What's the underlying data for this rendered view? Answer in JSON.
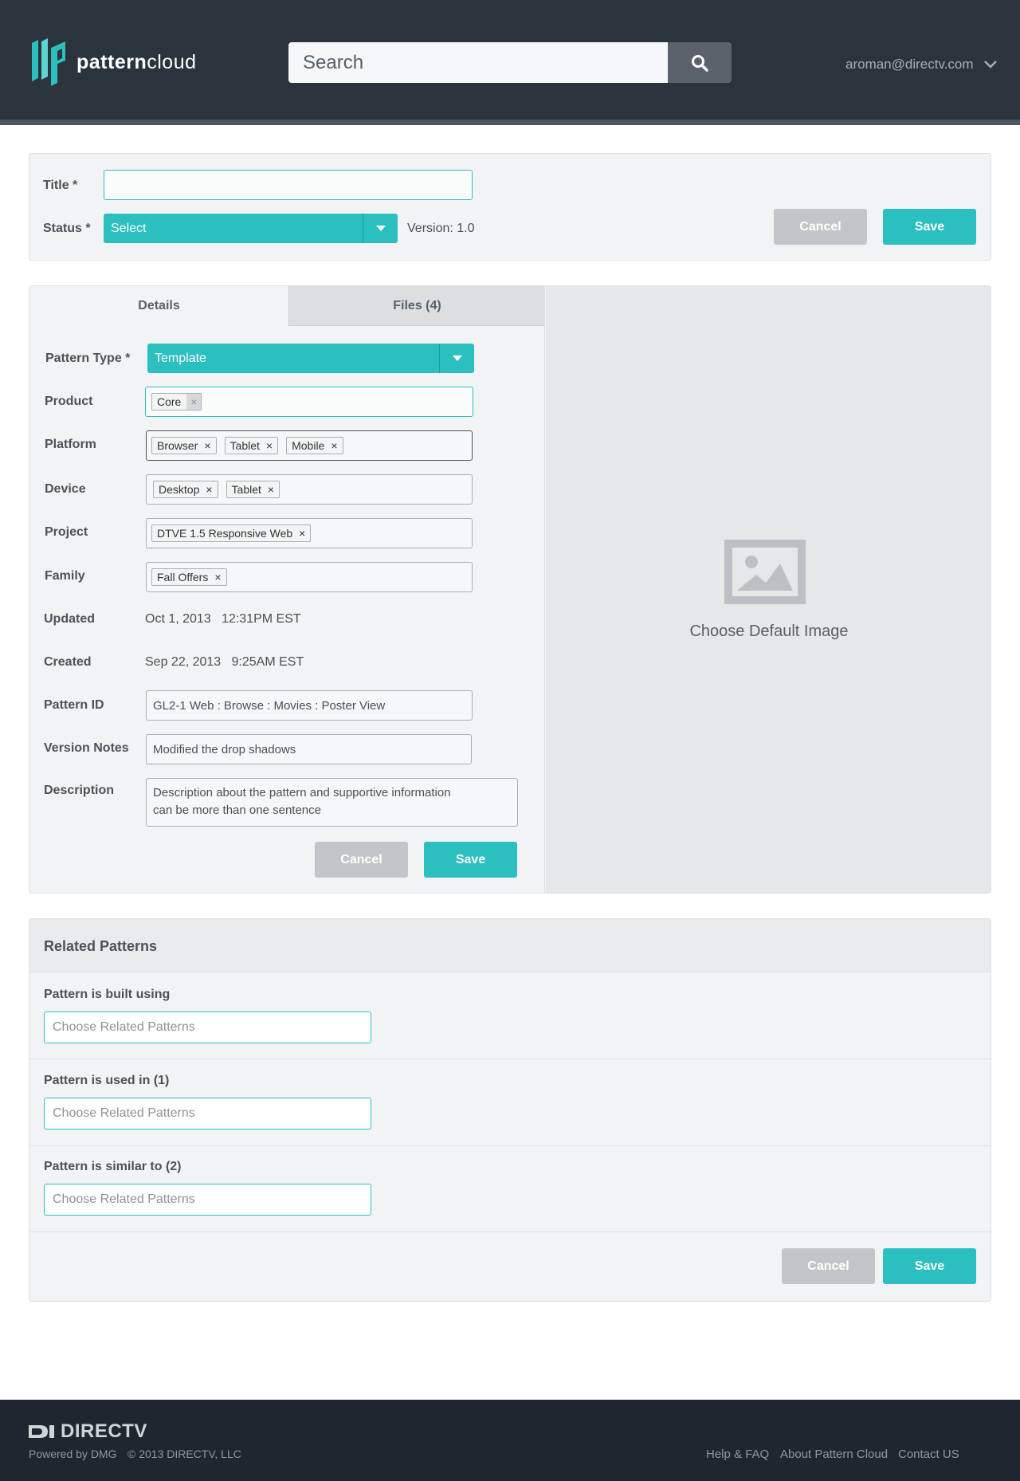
{
  "header": {
    "logo_text_bold": "pattern",
    "logo_text_light": "cloud",
    "search_placeholder": "Search",
    "user_email": "aroman@directv.com"
  },
  "top_form": {
    "title_label": "Title *",
    "title_value": "",
    "status_label": "Status *",
    "status_value": "Select",
    "version": "Version: 1.0",
    "cancel_label": "Cancel",
    "save_label": "Save"
  },
  "tabs": [
    {
      "label": "Details",
      "active": true
    },
    {
      "label": "Files (4)",
      "active": false
    }
  ],
  "details": {
    "pattern_type_label": "Pattern Type *",
    "pattern_type_value": "Template",
    "product_label": "Product",
    "product_tags": [
      "Core"
    ],
    "platform_label": "Platform",
    "platform_tags": [
      "Browser",
      "Tablet",
      "Mobile"
    ],
    "device_label": "Device",
    "device_tags": [
      "Desktop",
      "Tablet"
    ],
    "project_label": "Project",
    "project_tags": [
      "DTVE 1.5 Responsive Web"
    ],
    "family_label": "Family",
    "family_tags": [
      "Fall Offers"
    ],
    "updated_label": "Updated",
    "updated_value": "Oct 1, 2013   12:31PM EST",
    "created_label": "Created",
    "created_value": "Sep 22, 2013   9:25AM EST",
    "pattern_id_label": "Pattern ID",
    "pattern_id_value": "GL2-1 Web : Browse : Movies : Poster View",
    "version_notes_label": "Version Notes",
    "version_notes_value": "Modified the drop shadows",
    "description_label": "Description",
    "description_value": "Description about the pattern and supportive information can be more than one sentence",
    "cancel_label": "Cancel",
    "save_label": "Save"
  },
  "image_panel": {
    "choose_label": "Choose Default Image"
  },
  "related": {
    "heading": "Related Patterns",
    "sections": [
      {
        "label": "Pattern is built using",
        "placeholder": "Choose Related Patterns"
      },
      {
        "label": "Pattern is used in (1)",
        "placeholder": "Choose Related Patterns"
      },
      {
        "label": "Pattern is similar to (2)",
        "placeholder": "Choose Related Patterns"
      }
    ],
    "cancel_label": "Cancel",
    "save_label": "Save"
  },
  "footer": {
    "brand": "DIRECTV",
    "powered": "Powered by DMG",
    "copyright": "© 2013 DIRECTV, LLC",
    "links": [
      "Help & FAQ",
      "About Pattern Cloud",
      "Contact US"
    ]
  },
  "colors": {
    "accent": "#2bbfbf",
    "header_bg": "#2b333c",
    "footer_bg": "#1f262e",
    "cancel_bg": "#c2c5c9"
  },
  "icons": [
    "logo-icon",
    "search-icon",
    "chevron-down-icon",
    "dropdown-arrow-icon",
    "remove-tag-icon",
    "image-placeholder-icon",
    "directv-logo-icon"
  ]
}
